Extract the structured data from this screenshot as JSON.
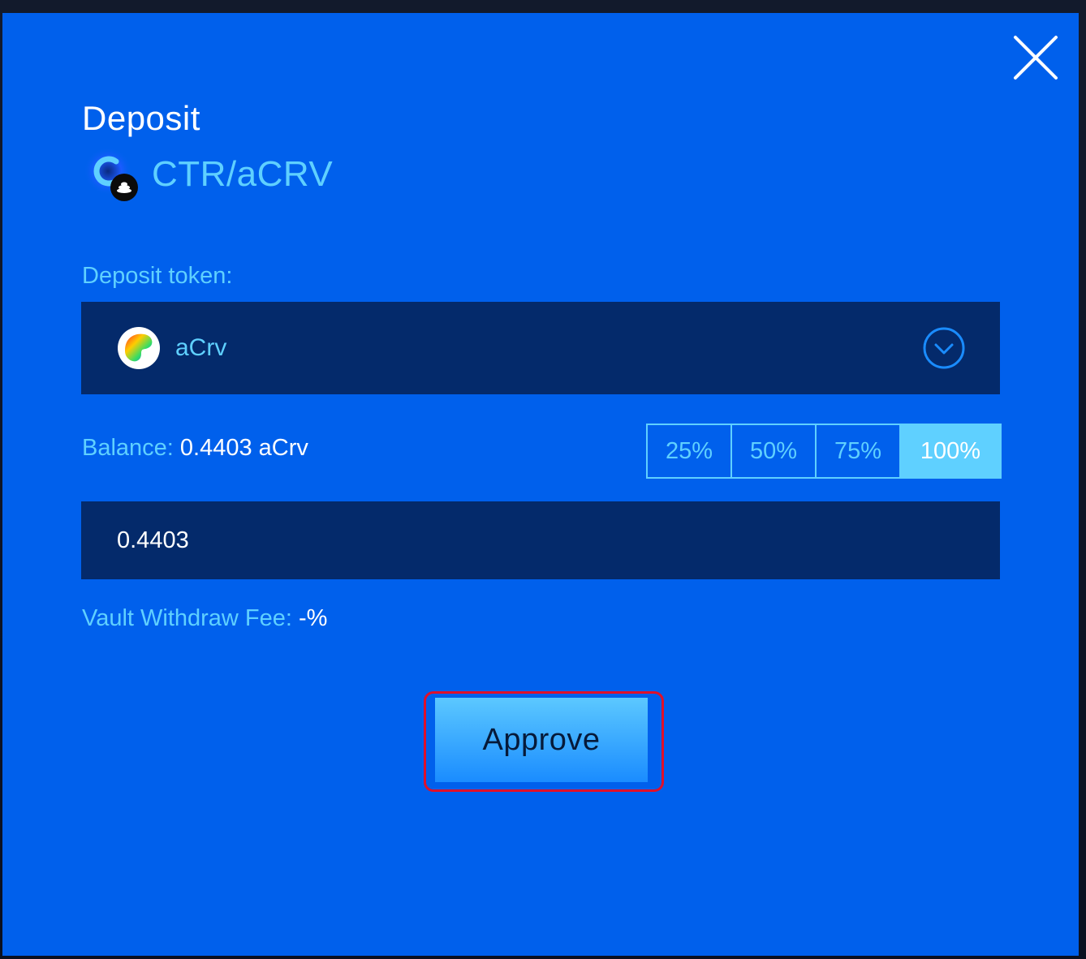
{
  "modal": {
    "title": "Deposit",
    "pair_name": "CTR/aCRV",
    "deposit_token_label": "Deposit token:",
    "selected_token": "aCrv",
    "balance_label": "Balance:",
    "balance_value": "0.4403 aCrv",
    "percent_options": [
      "25%",
      "50%",
      "75%",
      "100%"
    ],
    "active_percent": "100%",
    "amount_value": "0.4403",
    "fee_label": "Vault Withdraw Fee:",
    "fee_value": "-%",
    "approve_label": "Approve"
  },
  "icons": {
    "close": "close-icon",
    "pair": "ctr-acrv-pair-icon",
    "token": "acrv-token-icon",
    "dropdown": "chevron-down-circle-icon"
  },
  "colors": {
    "modal_bg": "#0060ec",
    "field_bg": "#042a6b",
    "accent": "#5fd0ff",
    "highlight_ring": "#e0102a"
  }
}
